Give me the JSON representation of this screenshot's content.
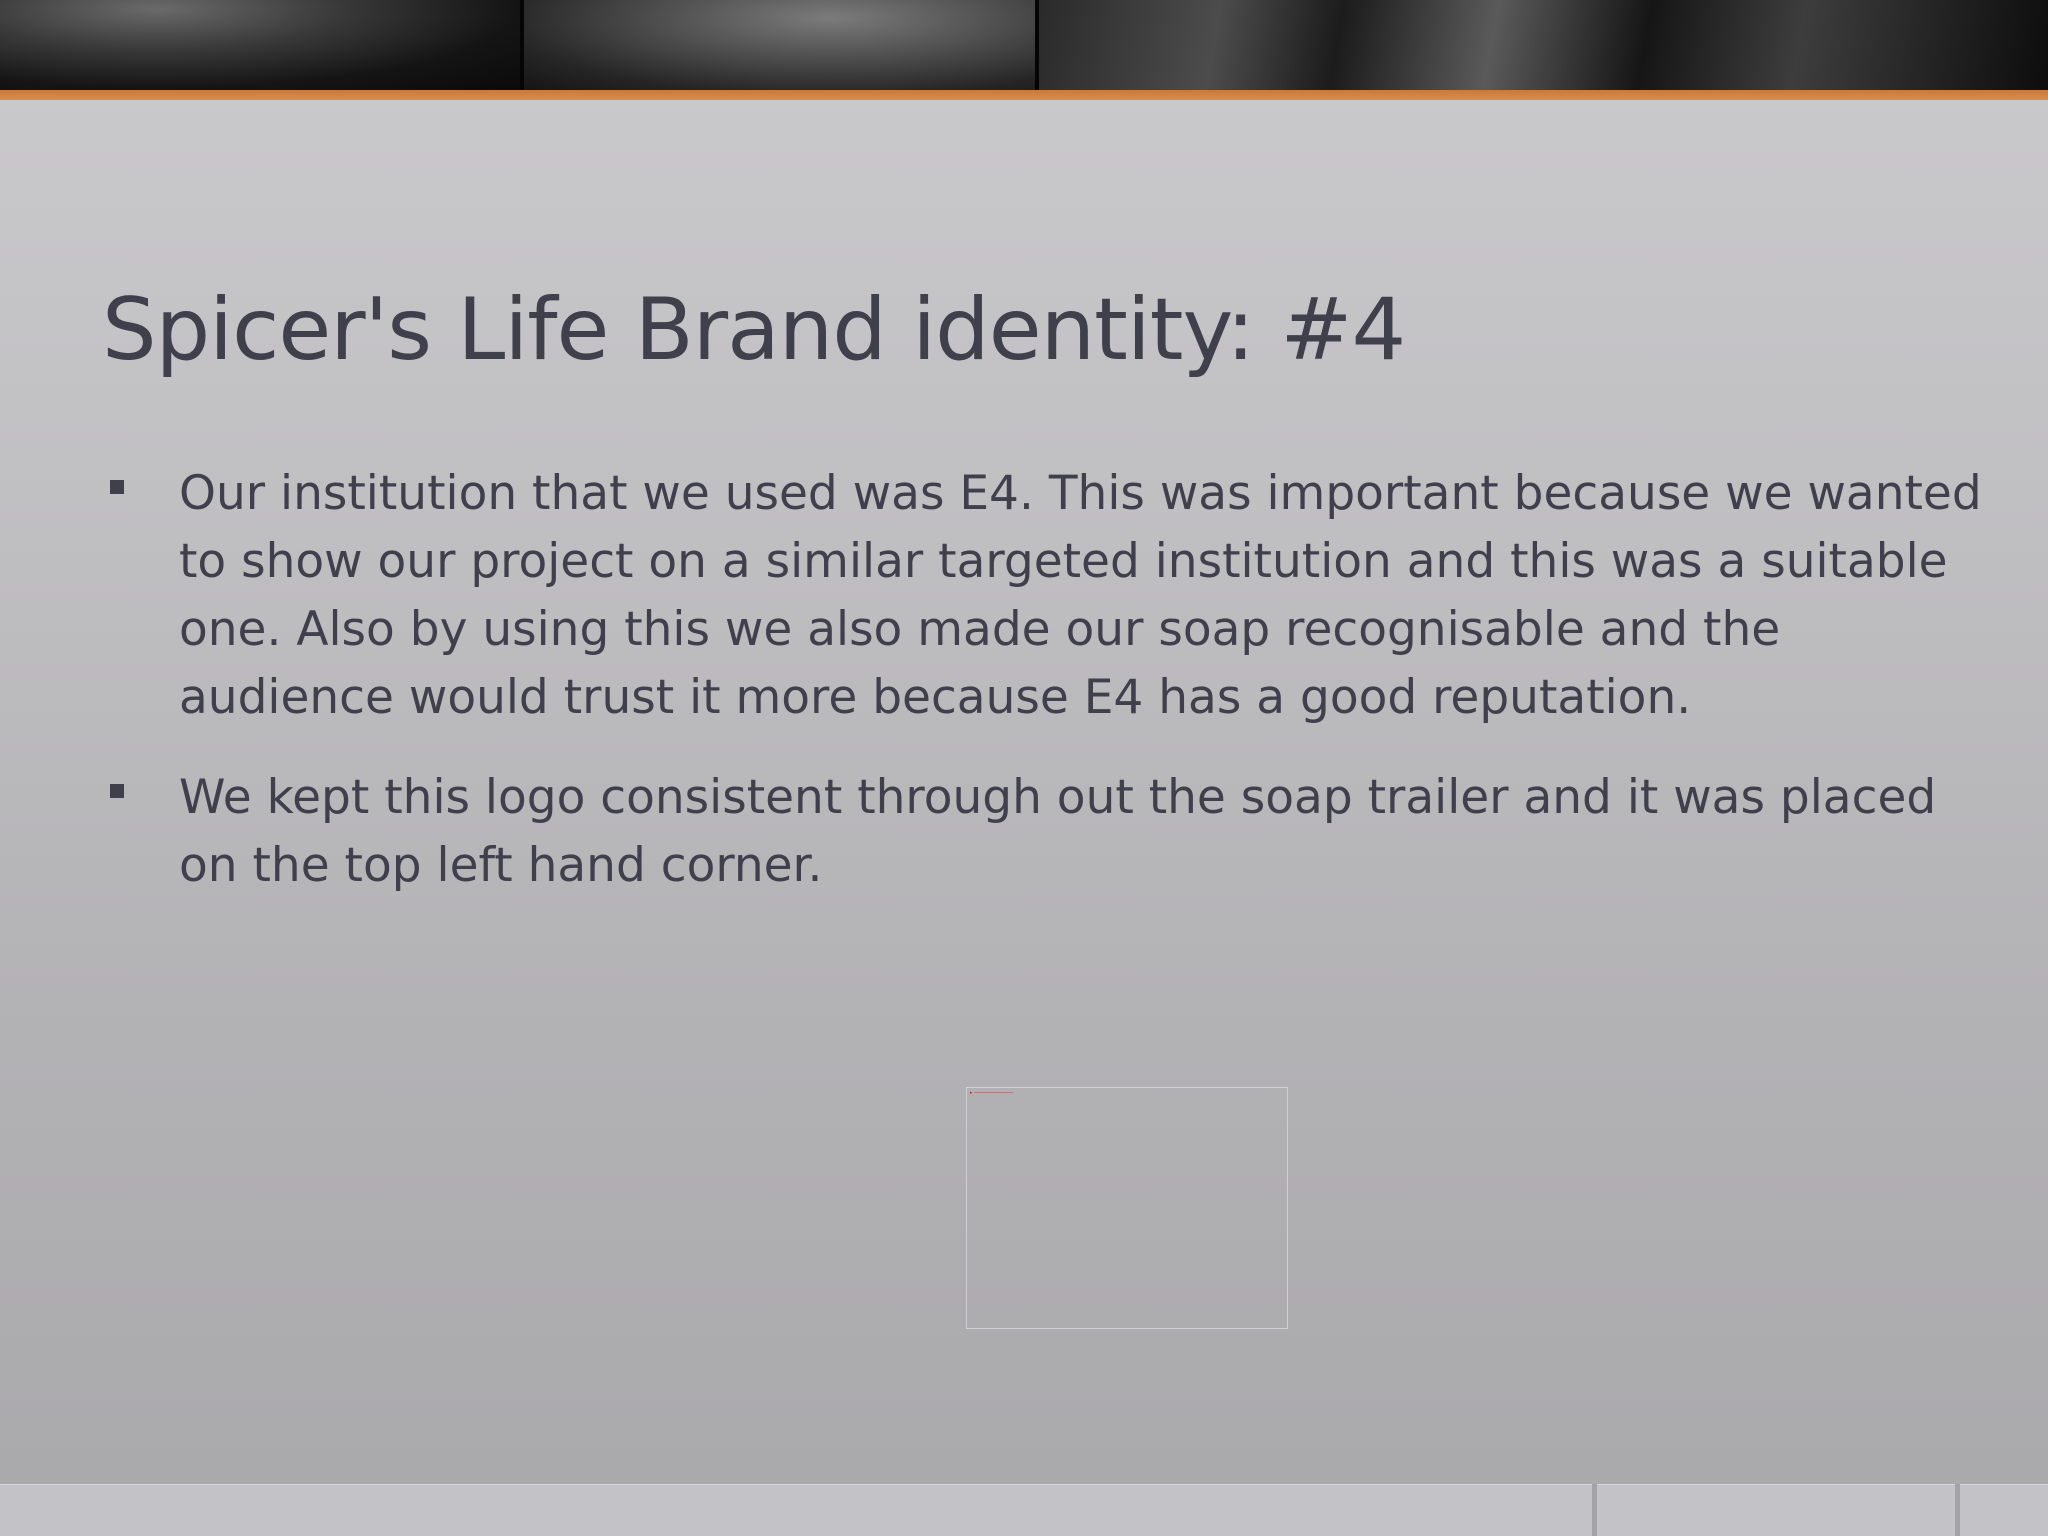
{
  "slide": {
    "title": "Spicer's Life Brand identity: #4",
    "bullets": [
      "Our institution that we used was E4. This was important because we wanted to show our project on a similar targeted institution and this was a suitable one. Also by using this we also made our soap recognisable and the audience would trust it more because E4 has a good reputation.",
      "We kept this logo consistent through out the soap trailer and it was placed on the top left hand corner."
    ]
  },
  "colors": {
    "text": "#403f4c",
    "accent_rule": "#d0874a",
    "background_top": "#cbcacd",
    "background_bottom": "#a9a8ab"
  }
}
